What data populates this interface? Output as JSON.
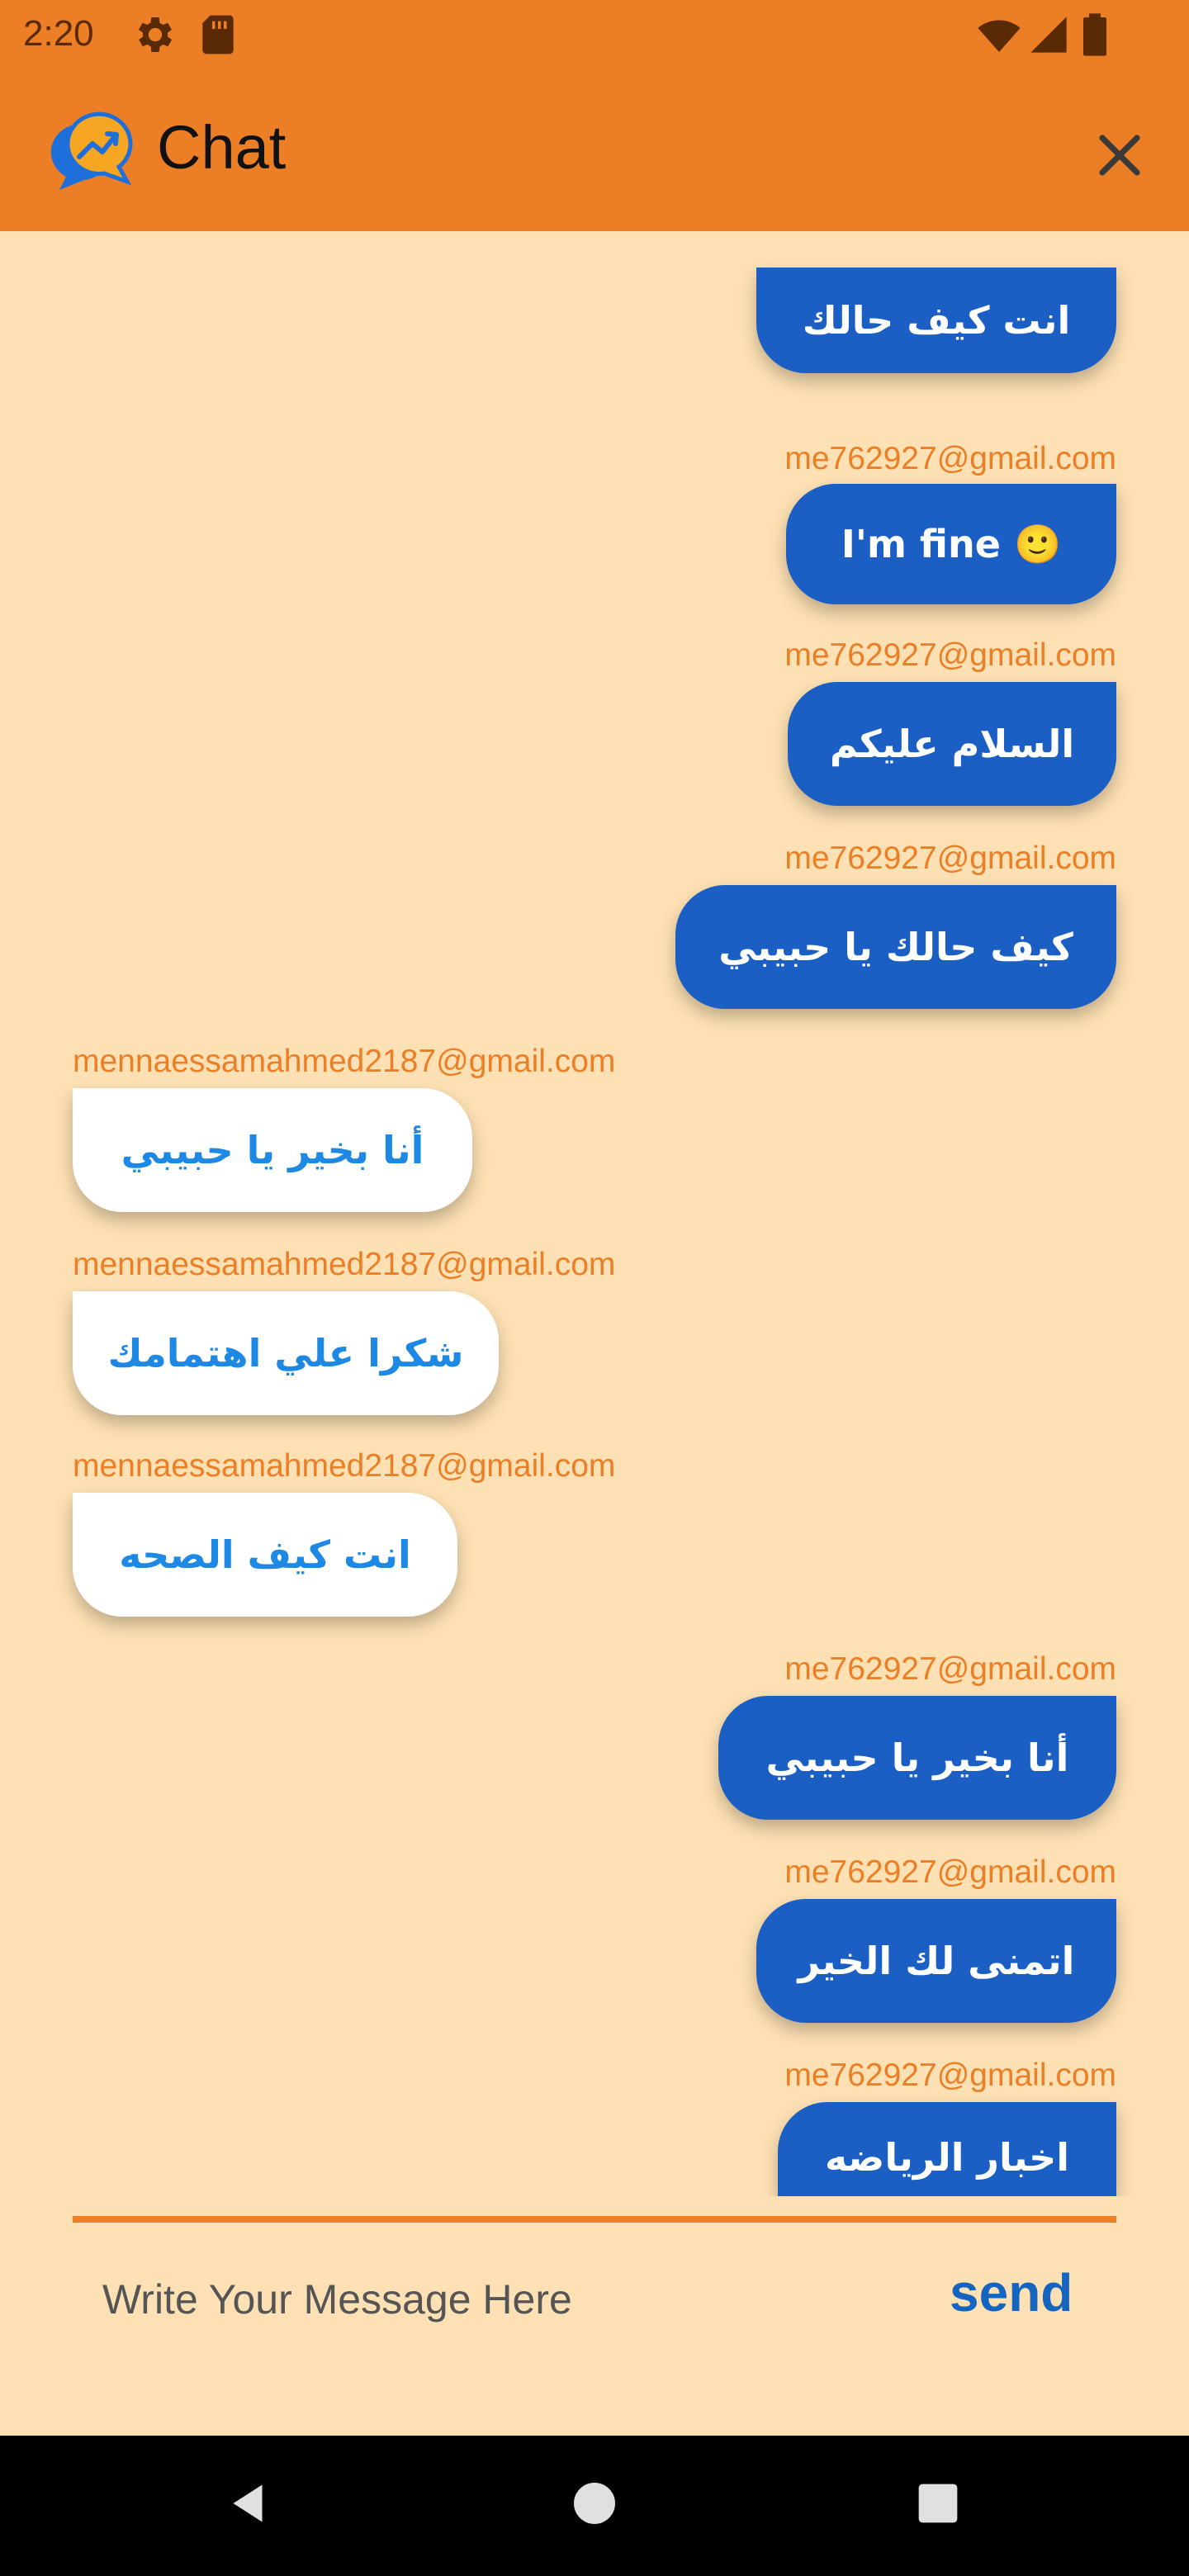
{
  "status_bar": {
    "time": "2:20"
  },
  "header": {
    "title": "Chat"
  },
  "messages": [
    {
      "sender": "me",
      "email": "",
      "text": "انت كيف حالك"
    },
    {
      "sender": "me",
      "email": "me762927@gmail.com",
      "text": "I'm fine 🙂"
    },
    {
      "sender": "me",
      "email": "me762927@gmail.com",
      "text": "السلام عليكم"
    },
    {
      "sender": "me",
      "email": "me762927@gmail.com",
      "text": "كيف حالك يا حبيبي"
    },
    {
      "sender": "other",
      "email": "mennaessamahmed2187@gmail.com",
      "text": "أنا بخير يا حبيبي"
    },
    {
      "sender": "other",
      "email": "mennaessamahmed2187@gmail.com",
      "text": "شكرا علي اهتمامك"
    },
    {
      "sender": "other",
      "email": "mennaessamahmed2187@gmail.com",
      "text": "انت كيف الصحه"
    },
    {
      "sender": "me",
      "email": "me762927@gmail.com",
      "text": "أنا بخير يا حبيبي"
    },
    {
      "sender": "me",
      "email": "me762927@gmail.com",
      "text": "اتمنى لك الخير"
    },
    {
      "sender": "me",
      "email": "me762927@gmail.com",
      "text": "اخبار الرياضه"
    }
  ],
  "composer": {
    "placeholder": "Write Your Message Here",
    "send_label": "send"
  },
  "colors": {
    "accent": "#EC7E25",
    "background": "#FDE1B4",
    "my_bubble": "#1B5FC4",
    "other_bubble": "#FFFFFF",
    "other_text": "#1E88E5"
  }
}
